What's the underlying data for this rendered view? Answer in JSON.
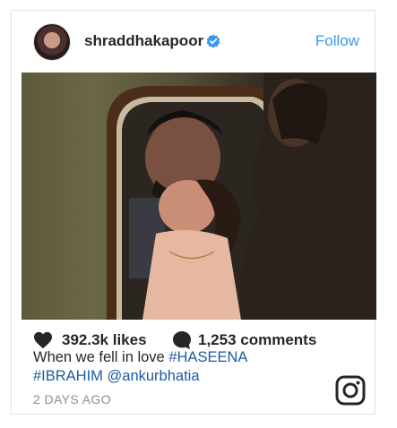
{
  "post": {
    "username": "shraddhakapoor",
    "follow_label": "Follow",
    "likes": "392.3k likes",
    "comments": "1,253 comments",
    "caption": {
      "text": "When we fell in love",
      "tag1": "#HASEENA",
      "tag2": "#IBRAHIM",
      "mention": "@ankurbhatia"
    },
    "time": "2 DAYS AGO"
  },
  "icons": {
    "verified": "verified-badge-icon",
    "like": "heart-icon",
    "comment": "comment-bubble-icon",
    "brand": "instagram-icon"
  },
  "colors": {
    "accent": "#3897f0",
    "tag": "#1d5aa0",
    "text": "#262626",
    "muted": "#8e8e8e"
  }
}
